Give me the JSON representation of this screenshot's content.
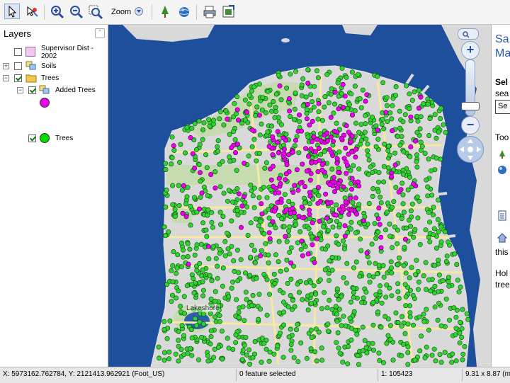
{
  "toolbar": {
    "zoom_label": "Zoom",
    "buttons": [
      "select-arrow",
      "identify",
      "zoom-in",
      "zoom-out",
      "zoom-extent",
      "zoom-dropdown",
      "tree-tool",
      "globe-tool",
      "print",
      "export"
    ]
  },
  "layers": {
    "title": "Layers",
    "items": [
      {
        "label": "Supervisor Dist - 2002",
        "line1": "Supervisor Dist -",
        "line2": "2002",
        "checked": false,
        "swatch": "#f0c8f0"
      },
      {
        "label": "Soils",
        "checked": false
      },
      {
        "label": "Trees",
        "checked": true
      },
      {
        "label": "Added Trees",
        "checked": true,
        "color": "#ee00ee"
      },
      {
        "label": "Trees",
        "checked": true,
        "color": "#00dd00"
      }
    ]
  },
  "map": {
    "place_label": "Lakeshore",
    "colors": {
      "water": "#1e4f9c",
      "land": "#d9d9d9",
      "park": "#c6dcb0",
      "road": "#f5eaa0",
      "added_tree": "#ee00ee",
      "tree": "#2fd42f"
    }
  },
  "right_panel": {
    "line1": "Sa",
    "line2": "Ma",
    "line3": "Sel",
    "line4": "sea",
    "line5": "Se",
    "line6": "Too",
    "line7": "this",
    "line8": "Hol",
    "line9": "tree"
  },
  "status": {
    "coords": "X: 5973162.762784, Y: 2121413.962921 (Foot_US)",
    "selection": "0 feature selected",
    "scale": "1: 105423",
    "size": "9.31 x 8.87 (m"
  }
}
